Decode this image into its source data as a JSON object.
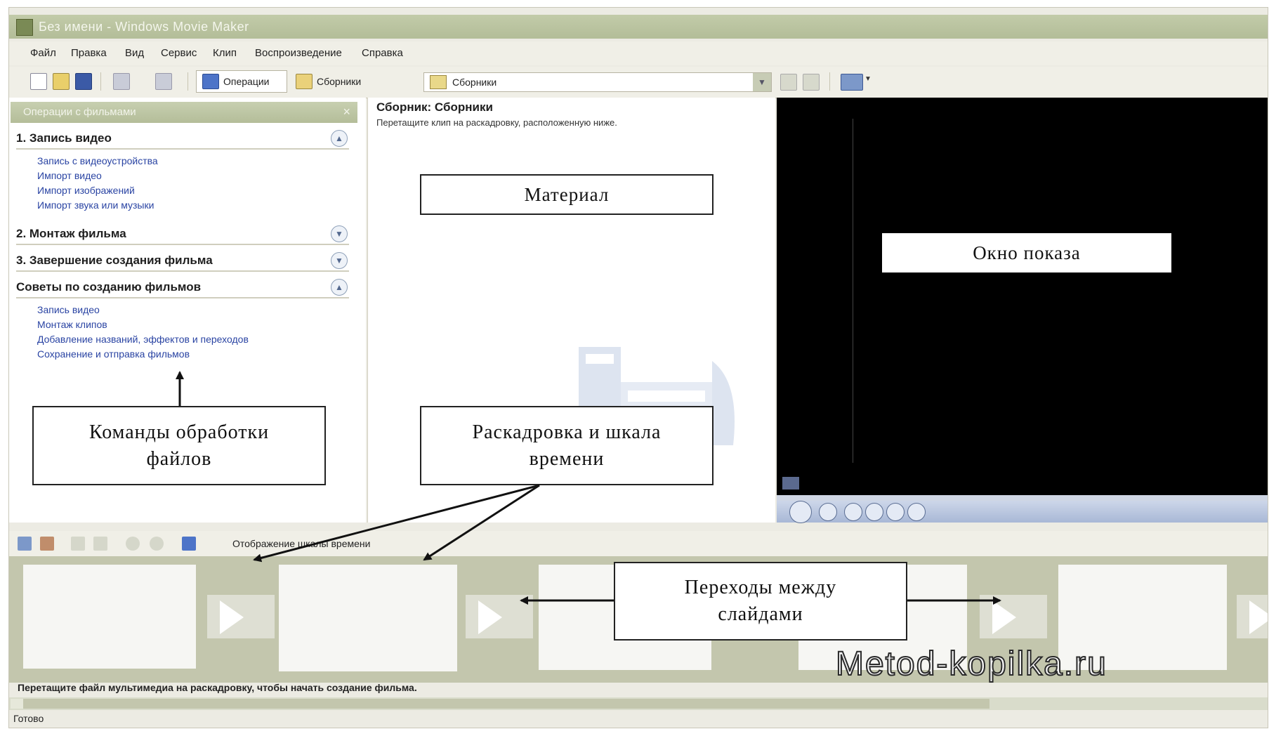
{
  "window": {
    "title": "Без имени - Windows Movie Maker"
  },
  "menu": [
    "Файл",
    "Правка",
    "Вид",
    "Сервис",
    "Клип",
    "Воспроизведение",
    "Справка"
  ],
  "toolbar": {
    "operations_label": "Операции",
    "collections_label": "Сборники",
    "collection_select_value": "Сборники"
  },
  "task_pane": {
    "header": "Операции с фильмами",
    "sections": [
      {
        "title": "1. Запись видео",
        "state": "expanded",
        "links": [
          "Запись с видеоустройства",
          "Импорт видео",
          "Импорт изображений",
          "Импорт звука или музыки"
        ]
      },
      {
        "title": "2. Монтаж фильма",
        "state": "collapsed",
        "links": []
      },
      {
        "title": "3. Завершение создания фильма",
        "state": "collapsed",
        "links": []
      },
      {
        "title": "Советы по созданию фильмов",
        "state": "expanded",
        "links": [
          "Запись видео",
          "Монтаж клипов",
          "Добавление названий, эффектов и переходов",
          "Сохранение и отправка фильмов"
        ]
      }
    ]
  },
  "collection_pane": {
    "title": "Сборник: Сборники",
    "subtitle": "Перетащите клип на раскадровку, расположенную ниже."
  },
  "timeline": {
    "toggle_label": "Отображение шкалы времени",
    "hint": "Перетащите файл мультимедиа на раскадровку, чтобы начать создание фильма."
  },
  "status": {
    "text": "Готово"
  },
  "annotations": {
    "material": "Материал",
    "preview_window": "Окно показа",
    "commands": [
      "Команды обработки",
      "файлов"
    ],
    "storyboard": [
      "Раскадровка и шкала",
      "времени"
    ],
    "transitions": [
      "Переходы между",
      "слайдами"
    ]
  },
  "watermark": "Metod-kopilka.ru",
  "colors": {
    "title_bar": "#b8c29d",
    "link": "#2a44a3",
    "storyboard_bg": "#c3c6ad",
    "preview_bg": "#000000"
  }
}
